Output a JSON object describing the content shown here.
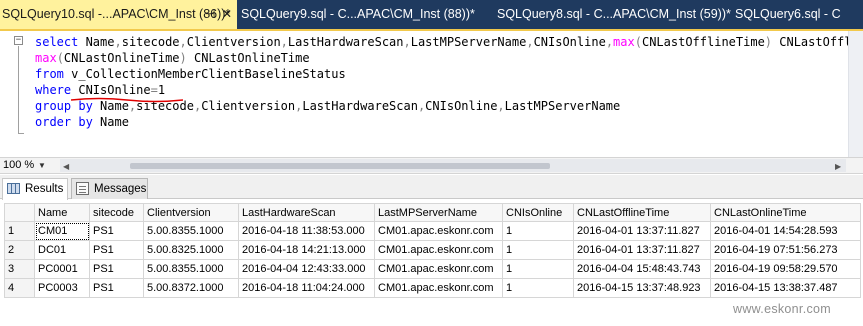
{
  "tabs": [
    {
      "label": "SQLQuery10.sql -...APAC\\CM_Inst (86))*",
      "active": true
    },
    {
      "label": "SQLQuery9.sql - C...APAC\\CM_Inst (88))*",
      "active": false
    },
    {
      "label": "SQLQuery8.sql - C...APAC\\CM_Inst (59))*",
      "active": false
    },
    {
      "label": "SQLQuery6.sql - C",
      "active": false
    }
  ],
  "editor": {
    "lines": [
      "select Name,sitecode,Clientversion,LastHardwareScan,LastMPServerName,CNIsOnline,max(CNLastOfflineTime) CNLastOfflineTi",
      "max(CNLastOnlineTime) CNLastOnlineTime",
      "from v_CollectionMemberClientBaselineStatus",
      "where CNIsOnline=1",
      "group by Name,sitecode,Clientversion,LastHardwareScan,CNIsOnline,LastMPServerName",
      "order by Name"
    ]
  },
  "zoom": "100 %",
  "result_tabs": {
    "results": "Results",
    "messages": "Messages"
  },
  "grid": {
    "columns": [
      "Name",
      "sitecode",
      "Clientversion",
      "LastHardwareScan",
      "LastMPServerName",
      "CNIsOnline",
      "CNLastOfflineTime",
      "CNLastOnlineTime"
    ],
    "rows": [
      [
        "1",
        "CM01",
        "PS1",
        "5.00.8355.1000",
        "2016-04-18 11:38:53.000",
        "CM01.apac.eskonr.com",
        "1",
        "2016-04-01 13:37:11.827",
        "2016-04-01 14:54:28.593"
      ],
      [
        "2",
        "DC01",
        "PS1",
        "5.00.8325.1000",
        "2016-04-18 14:21:13.000",
        "CM01.apac.eskonr.com",
        "1",
        "2016-04-01 13:37:11.827",
        "2016-04-19 07:51:56.273"
      ],
      [
        "3",
        "PC0001",
        "PS1",
        "5.00.8355.1000",
        "2016-04-04 12:43:33.000",
        "CM01.apac.eskonr.com",
        "1",
        "2016-04-04 15:48:43.743",
        "2016-04-19 09:58:29.570"
      ],
      [
        "4",
        "PC0003",
        "PS1",
        "5.00.8372.1000",
        "2016-04-18 11:04:24.000",
        "CM01.apac.eskonr.com",
        "1",
        "2016-04-15 13:37:48.923",
        "2016-04-15 13:38:37.487"
      ]
    ]
  },
  "watermark": "www.eskonr.com",
  "colors": {
    "tab_strip": "#1f3a5f",
    "active_tab": "#fff29d",
    "keyword": "#0000ff",
    "function": "#ff00ff",
    "operator": "#808080",
    "squiggle": "#e00000"
  }
}
